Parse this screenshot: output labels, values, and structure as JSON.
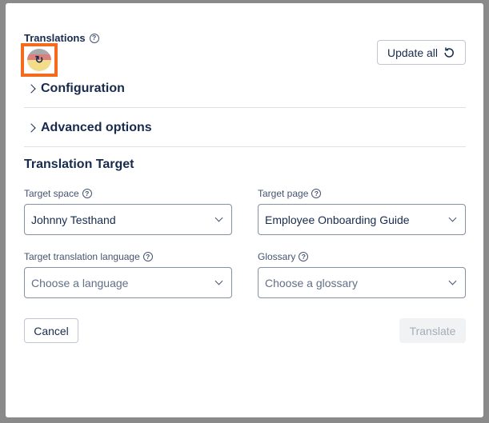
{
  "header": {
    "title": "Translations",
    "update_all_label": "Update all"
  },
  "sections": {
    "configuration": "Configuration",
    "advanced": "Advanced options"
  },
  "target": {
    "heading": "Translation Target",
    "space_label": "Target space",
    "space_value": "Johnny Testhand",
    "page_label": "Target page",
    "page_value": "Employee Onboarding Guide",
    "language_label": "Target translation language",
    "language_placeholder": "Choose a language",
    "glossary_label": "Glossary",
    "glossary_placeholder": "Choose a glossary"
  },
  "footer": {
    "cancel_label": "Cancel",
    "translate_label": "Translate"
  },
  "icons": {
    "help": "question-circle-icon",
    "refresh": "refresh-icon",
    "flag": "language-flag-icon"
  },
  "colors": {
    "highlight": "#f46b1e",
    "disabled_bg": "#f1f2f4",
    "disabled_text": "#a5adba"
  }
}
